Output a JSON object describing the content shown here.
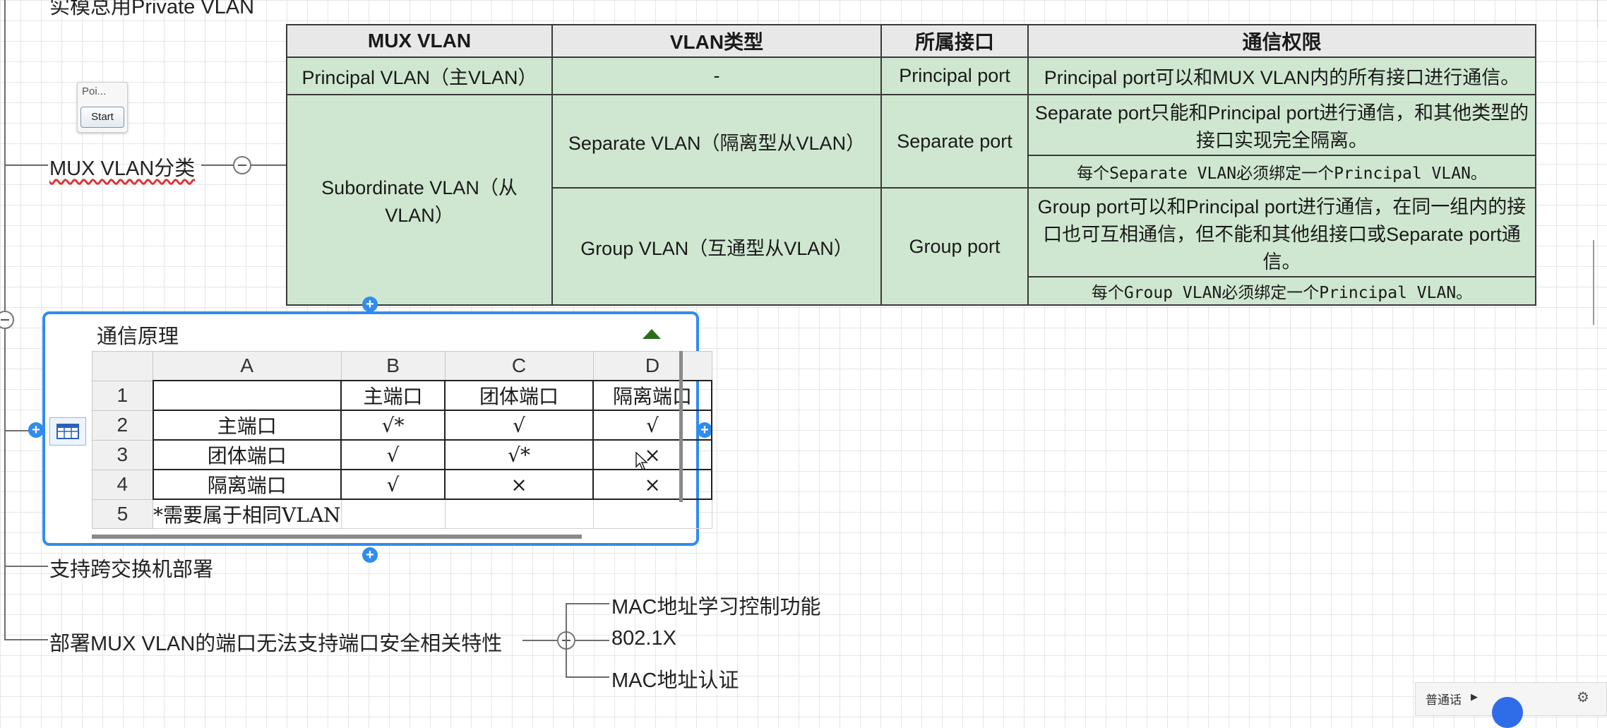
{
  "top_cut_text": "实模总用Private VLAN",
  "poi_widget": {
    "label": "Poi...",
    "button_label": "Start"
  },
  "topics": {
    "mux_classify": "MUX VLAN分类",
    "cross_switch": "支持跨交换机部署",
    "port_security": "部署MUX VLAN的端口无法支持端口安全相关特性"
  },
  "port_security_children": [
    "MAC地址学习控制功能",
    "802.1X",
    "MAC地址认证"
  ],
  "mux_table": {
    "headers": [
      "MUX VLAN",
      "VLAN类型",
      "所属接口",
      "通信权限"
    ],
    "principal": {
      "vlan": "Principal VLAN（主VLAN）",
      "type": "-",
      "port": "Principal port",
      "permission": "Principal port可以和MUX VLAN内的所有接口进行通信。"
    },
    "subordinate": {
      "vlan": "Subordinate VLAN（从VLAN）",
      "separate": {
        "type": "Separate VLAN（隔离型从VLAN）",
        "port": "Separate port",
        "permission": "Separate port只能和Principal port进行通信，和其他类型的接口实现完全隔离。",
        "note": "每个Separate VLAN必须绑定一个Principal VLAN。"
      },
      "group": {
        "type": "Group VLAN（互通型从VLAN）",
        "port": "Group port",
        "permission": "Group port可以和Principal port进行通信，在同一组内的接口也可互相通信，但不能和其他组接口或Separate port通信。",
        "note": "每个Group VLAN必须绑定一个Principal VLAN。"
      }
    }
  },
  "sheet": {
    "title": "通信原理",
    "col_headers": [
      "A",
      "B",
      "C",
      "D"
    ],
    "row_headers": [
      "1",
      "2",
      "3",
      "4",
      "5"
    ],
    "rows": [
      [
        "",
        "主端口",
        "团体端口",
        "隔离端口"
      ],
      [
        "主端口",
        "√*",
        "√",
        "√"
      ],
      [
        "团体端口",
        "√",
        "√*",
        "×"
      ],
      [
        "隔离端口",
        "√",
        "×",
        "×"
      ],
      [
        "*需要属于相同VLAN",
        "",
        "",
        ""
      ]
    ]
  },
  "status_widget": {
    "label": "普通话"
  }
}
